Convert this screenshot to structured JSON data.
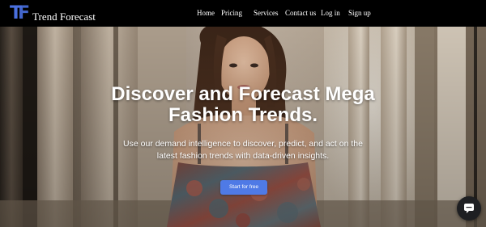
{
  "brand": {
    "logo_letters": "TF",
    "name": "Trend Forecast"
  },
  "nav": {
    "items": [
      {
        "id": "home",
        "label": "Home"
      },
      {
        "id": "pricing",
        "label": "Pricing"
      },
      {
        "id": "services",
        "label": "Services"
      },
      {
        "id": "contact",
        "label": "Contact us"
      },
      {
        "id": "login",
        "label": "Log in"
      },
      {
        "id": "signup",
        "label": "Sign up"
      }
    ]
  },
  "hero": {
    "headline_line1": "Discover and Forecast Mega",
    "headline_line2": "Fashion Trends.",
    "subtext_line1": "Use our demand intelligence to discover, predict, and act on the",
    "subtext_line2": "latest fashion trends with data-driven insights.",
    "cta_label": "Start for free"
  },
  "chat_widget": {
    "icon": "chat-icon"
  },
  "colors": {
    "header_bg": "#000000",
    "brand_accent": "#4a70e0",
    "cta_bg": "#4f7ae6",
    "chat_bg": "#1e1f22"
  }
}
